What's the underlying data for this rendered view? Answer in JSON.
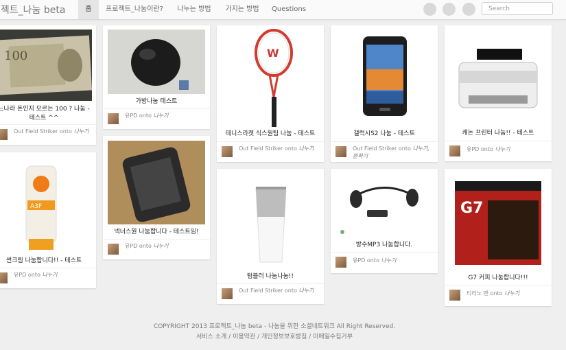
{
  "nav": {
    "brand": "로젝트_나눔 beta",
    "items": [
      "홈",
      "프로젝트_나눔이란?",
      "나누는 방법",
      "가지는 방법",
      "Questions"
    ],
    "search_placeholder": "Search"
  },
  "pins": [
    {
      "title": "느나라 돈인지 모르는 100 ? 나눔 - 테스트 ^^",
      "user": "Out Field Striker",
      "onto": "onto",
      "board": "나누기"
    },
    {
      "title": "썬크림 나눔합니다!! - 테스트",
      "user": "유PD",
      "onto": "onto",
      "board": "나누기"
    },
    {
      "title": "가방나눔 테스트",
      "user": "유PD",
      "onto": "onto",
      "board": "나누기"
    },
    {
      "title": "넥너스원 나눔합니다 - 테스트임!",
      "user": "유PD",
      "onto": "onto",
      "board": "나누기"
    },
    {
      "title": "테니스라켓 식스원팀 나눔 - 테스트",
      "user": "Out Field Striker",
      "onto": "onto",
      "board": "나누기"
    },
    {
      "title": "텀블러 나눔나눔!!",
      "user": "Out Field Striker",
      "onto": "onto",
      "board": "나누기"
    },
    {
      "title": "갤럭시S2 나눔 - 테스트",
      "user": "Out Field Striker",
      "onto": "onto",
      "board": "나누기, 원하기"
    },
    {
      "title": "방수MP3 나눔합니다.",
      "user": "유PD",
      "onto": "onto",
      "board": "나누기"
    },
    {
      "title": "캐논 프린터 나눔!! - 테스트",
      "user": "유PD",
      "onto": "onto",
      "board": "나누기"
    },
    {
      "title": "G7 커피 나눔합니다!!!",
      "user": "티라노 맨",
      "onto": "onto",
      "board": "나누기"
    }
  ],
  "footer": {
    "copyright": "COPYRIGHT 2013 프로젝트_나눔 beta - 나눔을 위한 소셜네트워크 All Right Reserved.",
    "links": [
      "서비스 소개",
      "이용약관",
      "개인정보보호방침",
      "이메일수집거부"
    ],
    "separator": "/"
  }
}
